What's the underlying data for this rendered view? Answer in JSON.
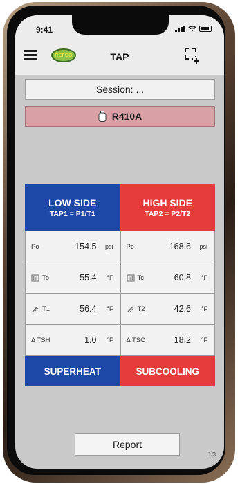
{
  "status": {
    "time": "9:41"
  },
  "header": {
    "title": "TAP",
    "logo_text": "REFCO"
  },
  "session": {
    "label": "Session: ..."
  },
  "refrigerant": {
    "name": "R410A"
  },
  "low_side": {
    "title": "LOW SIDE",
    "subtitle": "TAP1 = P1/T1"
  },
  "high_side": {
    "title": "HIGH SIDE",
    "subtitle": "TAP2 = P2/T2"
  },
  "rows": [
    {
      "left": {
        "label": "Po",
        "value": "154.5",
        "unit": "psi"
      },
      "right": {
        "label": "Pc",
        "value": "168.6",
        "unit": "psi"
      }
    },
    {
      "left": {
        "label": "To",
        "value": "55.4",
        "unit": "°F"
      },
      "right": {
        "label": "Tc",
        "value": "60.8",
        "unit": "°F"
      }
    },
    {
      "left": {
        "label": "T1",
        "value": "56.4",
        "unit": "°F"
      },
      "right": {
        "label": "T2",
        "value": "42.6",
        "unit": "°F"
      }
    },
    {
      "left": {
        "label": "Δ TSH",
        "value": "1.0",
        "unit": "°F"
      },
      "right": {
        "label": "Δ TSC",
        "value": "18.2",
        "unit": "°F"
      }
    }
  ],
  "footer": {
    "left": "SUPERHEAT",
    "right": "SUBCOOLING"
  },
  "report": {
    "label": "Report"
  },
  "page": "1/3",
  "colors": {
    "blue": "#1d48a8",
    "red": "#e53b3b",
    "refrigerant_bg": "#d9a0a6"
  },
  "icons": {
    "menu": "hamburger-menu-icon",
    "scan": "scan-frame-icon",
    "gas": "gas-cylinder-icon",
    "temperature": "thermometer-icon",
    "probe": "probe-icon"
  }
}
